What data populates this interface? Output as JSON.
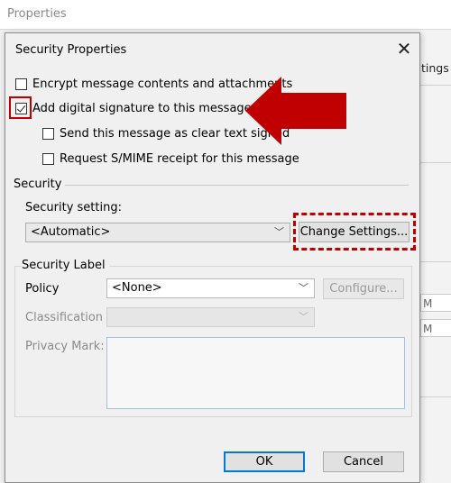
{
  "background": {
    "window_title": "Properties",
    "right_text": "tings f",
    "right_field1": "M",
    "right_field2": "M"
  },
  "dialog": {
    "title": "Security Properties",
    "close_icon": "close-icon",
    "encrypt_label": "Encrypt message contents and attachments",
    "encrypt_checked": false,
    "signature_label": "Add digital signature to this message",
    "signature_checked": true,
    "cleartext_label": "Send this message as clear text signed",
    "cleartext_checked": false,
    "smime_label": "Request S/MIME receipt for this message",
    "smime_checked": false,
    "security_group": "Security",
    "security_setting_label": "Security setting:",
    "security_setting_value": "<Automatic>",
    "change_settings_label": "Change Settings...",
    "security_label_group": "Security Label",
    "policy_label": "Policy",
    "policy_value": "<None>",
    "configure_label": "Configure...",
    "classification_label": "Classification",
    "classification_value": "",
    "privacy_mark_label": "Privacy Mark:",
    "ok_label": "OK",
    "cancel_label": "Cancel"
  },
  "annotations": {
    "highlight_color": "#c00000",
    "arrow_icon": "red-arrow-icon"
  }
}
